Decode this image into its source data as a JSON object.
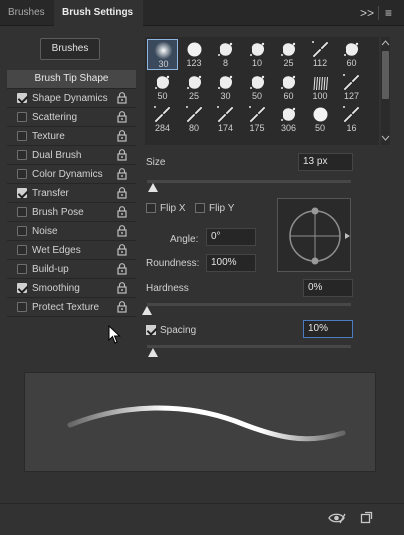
{
  "tabs": {
    "brushes": "Brushes",
    "brush_settings": "Brush Settings"
  },
  "tab_controls": {
    "collapse": ">>",
    "menu": "≡"
  },
  "brushes_button": "Brushes",
  "options": [
    {
      "label": "Brush Tip Shape",
      "header": true
    },
    {
      "label": "Shape Dynamics",
      "checked": true
    },
    {
      "label": "Scattering",
      "checked": false
    },
    {
      "label": "Texture",
      "checked": false
    },
    {
      "label": "Dual Brush",
      "checked": false
    },
    {
      "label": "Color Dynamics",
      "checked": false
    },
    {
      "label": "Transfer",
      "checked": true
    },
    {
      "label": "Brush Pose",
      "checked": false
    },
    {
      "label": "Noise",
      "checked": false
    },
    {
      "label": "Wet Edges",
      "checked": false
    },
    {
      "label": "Build-up",
      "checked": false
    },
    {
      "label": "Smoothing",
      "checked": true
    },
    {
      "label": "Protect Texture",
      "checked": false
    }
  ],
  "brush_presets": [
    {
      "size": "30",
      "shape": "soft",
      "selected": true
    },
    {
      "size": "123",
      "shape": "hard"
    },
    {
      "size": "8",
      "shape": "splat"
    },
    {
      "size": "10",
      "shape": "splat"
    },
    {
      "size": "25",
      "shape": "splat"
    },
    {
      "size": "112",
      "shape": "dots"
    },
    {
      "size": "60",
      "shape": "splat"
    },
    {
      "size": "50",
      "shape": "splat"
    },
    {
      "size": "25",
      "shape": "splat"
    },
    {
      "size": "30",
      "shape": "splat"
    },
    {
      "size": "50",
      "shape": "splat"
    },
    {
      "size": "60",
      "shape": "splat"
    },
    {
      "size": "100",
      "shape": "grass"
    },
    {
      "size": "127",
      "shape": "dots"
    },
    {
      "size": "284",
      "shape": "dots"
    },
    {
      "size": "80",
      "shape": "dots"
    },
    {
      "size": "174",
      "shape": "dots"
    },
    {
      "size": "175",
      "shape": "dots"
    },
    {
      "size": "306",
      "shape": "splat"
    },
    {
      "size": "50",
      "shape": "hard"
    },
    {
      "size": "16",
      "shape": "dots"
    }
  ],
  "size": {
    "label": "Size",
    "value": "13 px",
    "slider_fraction": 0.03
  },
  "flip_x": {
    "label": "Flip X",
    "checked": false
  },
  "flip_y": {
    "label": "Flip Y",
    "checked": false
  },
  "angle": {
    "label": "Angle:",
    "value": "0°"
  },
  "roundness": {
    "label": "Roundness:",
    "value": "100%"
  },
  "hardness": {
    "label": "Hardness",
    "value": "0%",
    "slider_fraction": 0.0
  },
  "spacing": {
    "label": "Spacing",
    "value": "10%",
    "checked": true,
    "slider_fraction": 0.03
  },
  "colors": {
    "panel": "#323232",
    "tabbar": "#282828",
    "stroke": "#ffffff",
    "focus": "#4a7dbf"
  }
}
